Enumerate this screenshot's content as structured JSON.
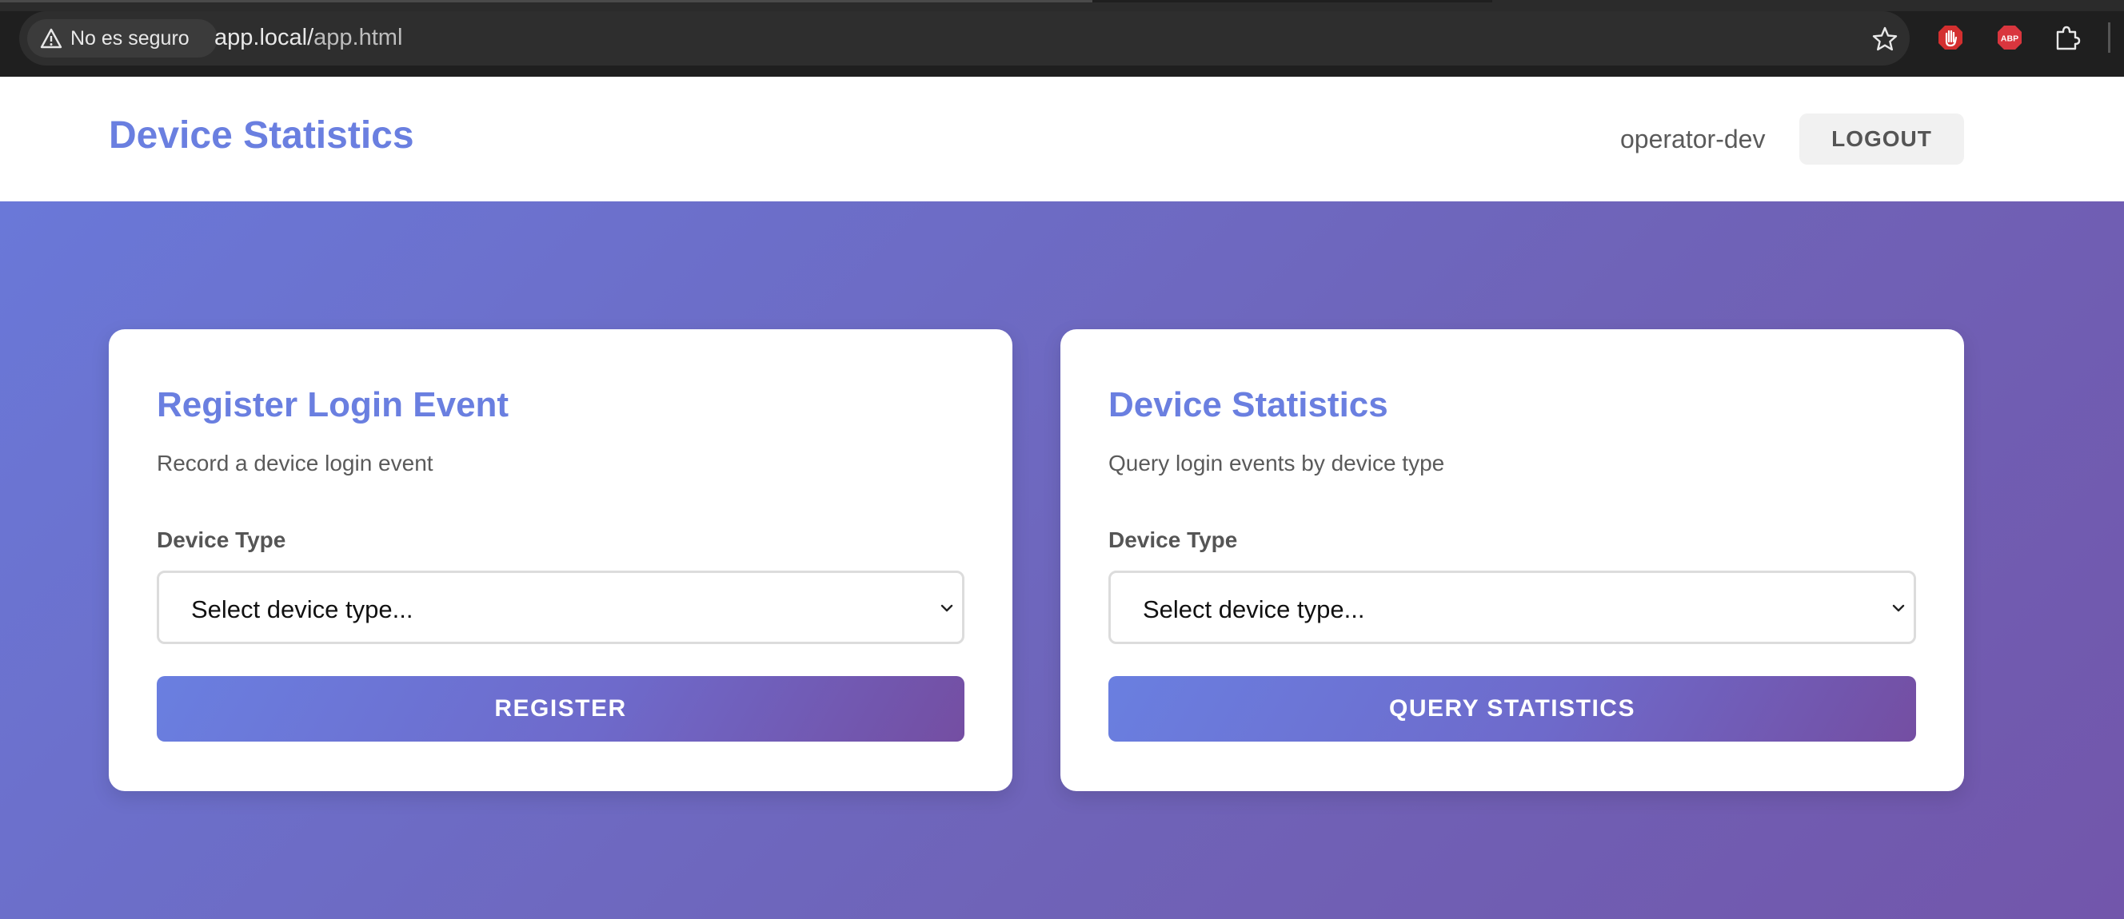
{
  "browser": {
    "security_label": "No es seguro",
    "url_host": "app.local/",
    "url_path": "app.html",
    "icons": [
      "warning-icon",
      "star-icon",
      "stop-hand-extension-icon",
      "adblock-extension-icon",
      "puzzle-extension-icon"
    ]
  },
  "header": {
    "title": "Device Statistics",
    "username": "operator-dev",
    "logout_label": "LOGOUT"
  },
  "register_card": {
    "title": "Register Login Event",
    "description": "Record a device login event",
    "field_label": "Device Type",
    "select_value": "Select device type...",
    "button_label": "REGISTER"
  },
  "stats_card": {
    "title": "Device Statistics",
    "description": "Query login events by device type",
    "field_label": "Device Type",
    "select_value": "Select device type...",
    "button_label": "QUERY STATISTICS"
  },
  "colors": {
    "accent": "#6a7fe0",
    "gradient_start": "#6a78d8",
    "gradient_end": "#7256ab",
    "card_bg": "#ffffff"
  }
}
